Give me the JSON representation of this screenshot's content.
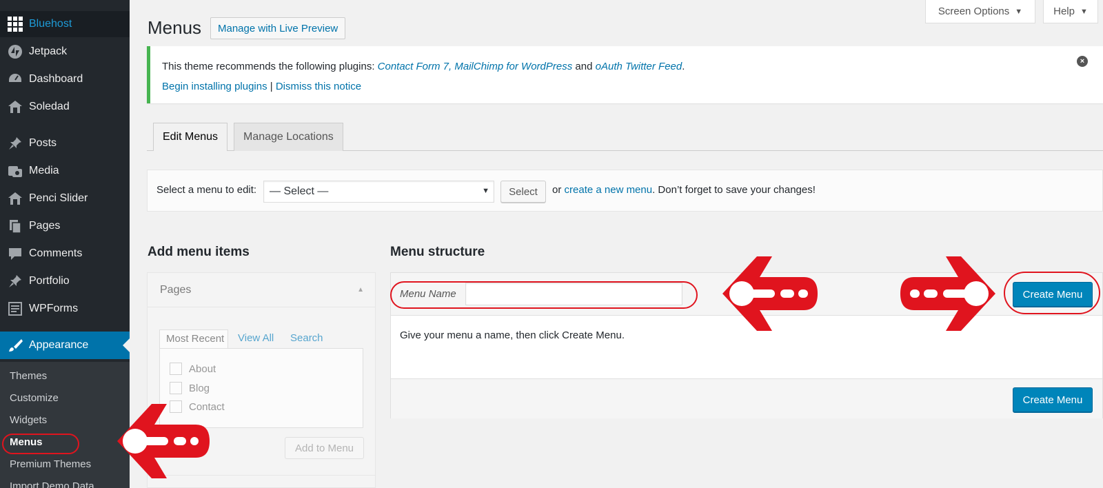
{
  "sidebar": {
    "items": [
      {
        "label": "Bluehost",
        "icon": "grid-icon"
      },
      {
        "label": "Jetpack",
        "icon": "jetpack-icon"
      },
      {
        "label": "Dashboard",
        "icon": "dashboard-icon"
      },
      {
        "label": "Soledad",
        "icon": "home-icon"
      },
      {
        "label": "Posts",
        "icon": "pin-icon"
      },
      {
        "label": "Media",
        "icon": "media-icon"
      },
      {
        "label": "Penci Slider",
        "icon": "home-icon"
      },
      {
        "label": "Pages",
        "icon": "pages-icon"
      },
      {
        "label": "Comments",
        "icon": "comment-icon"
      },
      {
        "label": "Portfolio",
        "icon": "pin-icon"
      },
      {
        "label": "WPForms",
        "icon": "forms-icon"
      },
      {
        "label": "Appearance",
        "icon": "brush-icon"
      }
    ],
    "submenu": [
      "Themes",
      "Customize",
      "Widgets",
      "Menus",
      "Premium Themes",
      "Import Demo Data"
    ]
  },
  "top_tabs": {
    "screen_options": "Screen Options",
    "help": "Help"
  },
  "header": {
    "title": "Menus",
    "live_preview": "Manage with Live Preview"
  },
  "notice": {
    "prefix": "This theme recommends the following plugins: ",
    "plugin1": "Contact Form 7",
    "sep1": ", ",
    "plugin2": "MailChimp for WordPress",
    "sep2": " and ",
    "plugin3": "oAuth Twitter Feed",
    "suffix": ".",
    "begin": "Begin installing plugins",
    "divider": " | ",
    "dismiss": "Dismiss this notice"
  },
  "nav_tabs": {
    "edit": "Edit Menus",
    "locations": "Manage Locations"
  },
  "manage": {
    "label": "Select a menu to edit:",
    "select_value": "— Select —",
    "select_button": "Select",
    "hint_or": "or ",
    "hint_link": "create a new menu",
    "hint_rest": ". Don’t forget to save your changes!"
  },
  "add_items": {
    "title": "Add menu items",
    "pages_title": "Pages",
    "tabs": {
      "recent": "Most Recent",
      "view_all": "View All",
      "search": "Search"
    },
    "pages": [
      "About",
      "Blog",
      "Contact"
    ],
    "add_button": "Add to Menu"
  },
  "structure": {
    "title": "Menu structure",
    "name_label": "Menu Name",
    "name_value": "",
    "create_button": "Create Menu",
    "help_text": "Give your menu a name, then click Create Menu."
  },
  "colors": {
    "sidebar": "#23282d",
    "accent": "#0073aa",
    "primary_button": "#0085ba",
    "annotation_red": "#e0141e",
    "notice_green": "#46b450"
  }
}
